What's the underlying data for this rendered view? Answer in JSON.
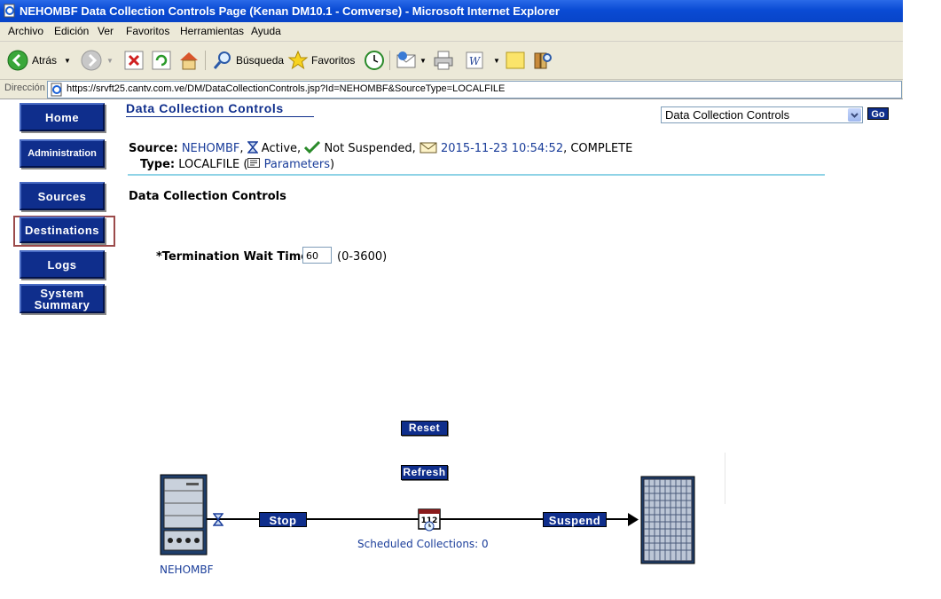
{
  "window": {
    "title": "NEHOMBF Data Collection Controls Page (Kenan DM10.1 - Comverse) - Microsoft Internet Explorer"
  },
  "menu": [
    "Archivo",
    "Edición",
    "Ver",
    "Favoritos",
    "Herramientas",
    "Ayuda"
  ],
  "toolbar": {
    "back_label": "Atrás",
    "search_label": "Búsqueda",
    "favorites_label": "Favoritos"
  },
  "address": {
    "label": "Dirección",
    "url": "https://srvft25.cantv.com.ve/DM/DataCollectionControls.jsp?Id=NEHOMBF&SourceType=LOCALFILE"
  },
  "nav": {
    "home": "Home",
    "administration": "Administration",
    "sources": "Sources",
    "destinations": "Destinations",
    "logs": "Logs",
    "system": "System",
    "summary": "Summary"
  },
  "page": {
    "heading": "Data Collection Controls",
    "select_value": "Data Collection Controls",
    "go_label": "Go"
  },
  "source": {
    "label": "Source:",
    "name": "NEHOMBF",
    "status": "Active,",
    "suspend_status": "Not Suspended,",
    "timestamp": "2015-11-23 10:54:52",
    "result": ", COMPLETE",
    "type_label": "Type:",
    "type_value": "LOCALFILE (",
    "parameters_link": "Parameters",
    "close_paren": ")"
  },
  "section_title": "Data Collection Controls",
  "termination": {
    "label": "*Termination Wait Time:",
    "value": "60",
    "range": "(0-3600)"
  },
  "buttons": {
    "reset": "Reset",
    "refresh": "Refresh",
    "stop": "Stop",
    "suspend": "Suspend"
  },
  "diagram": {
    "source_name": "NEHOMBF",
    "scheduled": "Scheduled Collections: 0"
  },
  "colors": {
    "button_blue": "#0f2e8c",
    "link_blue": "#1a3d9a",
    "separator": "#8fd3e6"
  }
}
